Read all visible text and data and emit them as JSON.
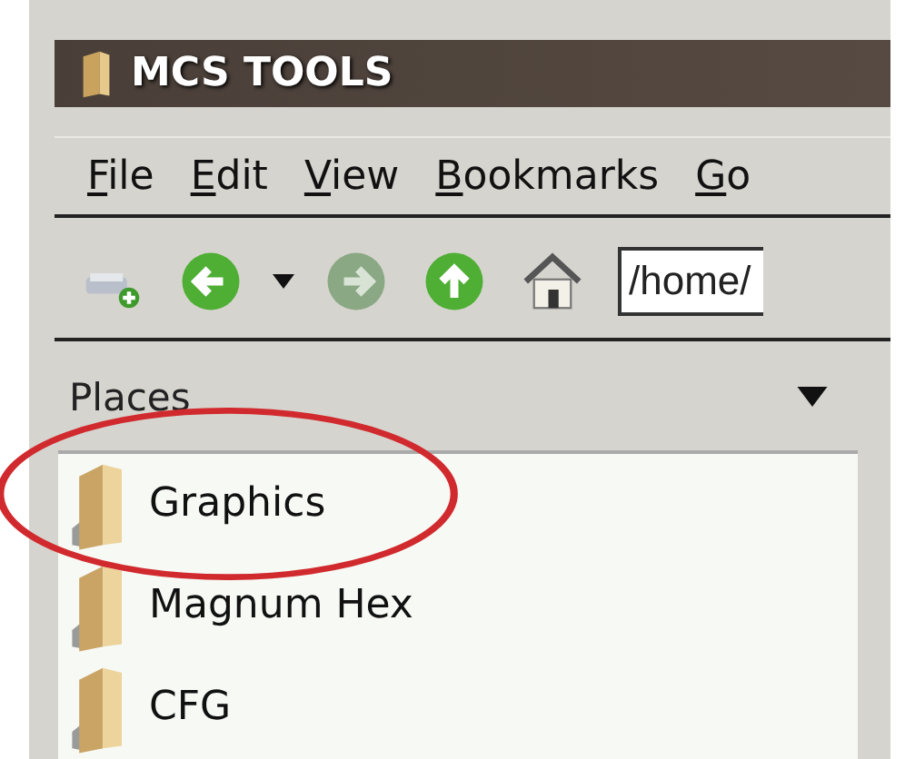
{
  "window": {
    "title": "MCS TOOLS"
  },
  "menu": [
    {
      "label": "File"
    },
    {
      "label": "Edit"
    },
    {
      "label": "View"
    },
    {
      "label": "Bookmarks"
    },
    {
      "label": "Go"
    }
  ],
  "toolbar": {
    "path": "/home/"
  },
  "sidebar": {
    "header": "Places",
    "items": [
      {
        "label": "Graphics"
      },
      {
        "label": "Magnum Hex"
      },
      {
        "label": "CFG"
      }
    ]
  }
}
